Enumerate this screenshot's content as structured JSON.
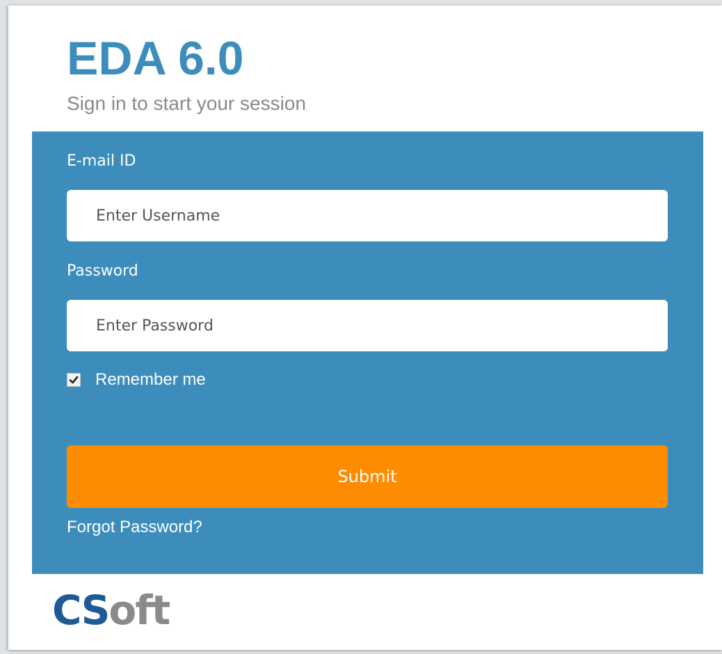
{
  "header": {
    "app_title": "EDA 6.0",
    "subtitle": "Sign in to start your session"
  },
  "form": {
    "email_label": "E-mail ID",
    "email_placeholder": "Enter Username",
    "password_label": "Password",
    "password_placeholder": "Enter Password",
    "remember_label": "Remember me",
    "remember_checked": true,
    "submit_label": "Submit",
    "forgot_label": "Forgot Password?"
  },
  "footer": {
    "logo_part1": "CS",
    "logo_part2": "oft"
  },
  "colors": {
    "accent": "#3c8dbc",
    "submit": "#ff8c00",
    "logo_blue": "#1f5a96",
    "logo_gray": "#8a8a8a"
  },
  "icons": {
    "checkbox": "checkmark-icon"
  }
}
